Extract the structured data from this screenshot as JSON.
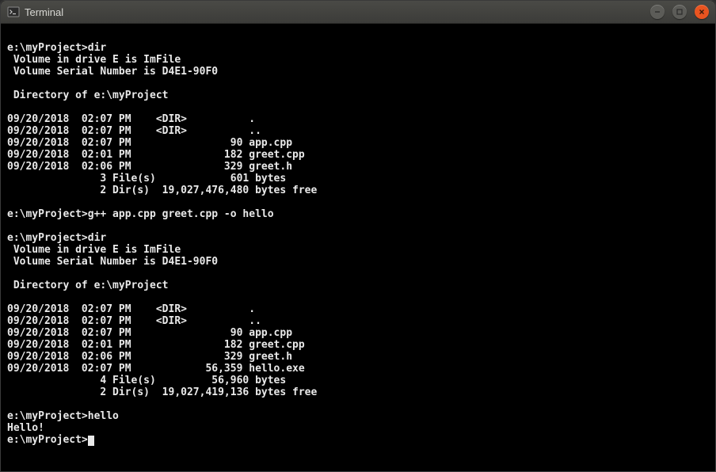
{
  "window": {
    "title": "Terminal"
  },
  "terminal": {
    "lines": [
      "",
      "e:\\myProject>dir",
      " Volume in drive E is ImFile",
      " Volume Serial Number is D4E1-90F0",
      "",
      " Directory of e:\\myProject",
      "",
      "09/20/2018  02:07 PM    <DIR>          .",
      "09/20/2018  02:07 PM    <DIR>          ..",
      "09/20/2018  02:07 PM                90 app.cpp",
      "09/20/2018  02:01 PM               182 greet.cpp",
      "09/20/2018  02:06 PM               329 greet.h",
      "               3 File(s)            601 bytes",
      "               2 Dir(s)  19,027,476,480 bytes free",
      "",
      "e:\\myProject>g++ app.cpp greet.cpp -o hello",
      "",
      "e:\\myProject>dir",
      " Volume in drive E is ImFile",
      " Volume Serial Number is D4E1-90F0",
      "",
      " Directory of e:\\myProject",
      "",
      "09/20/2018  02:07 PM    <DIR>          .",
      "09/20/2018  02:07 PM    <DIR>          ..",
      "09/20/2018  02:07 PM                90 app.cpp",
      "09/20/2018  02:01 PM               182 greet.cpp",
      "09/20/2018  02:06 PM               329 greet.h",
      "09/20/2018  02:07 PM            56,359 hello.exe",
      "               4 File(s)         56,960 bytes",
      "               2 Dir(s)  19,027,419,136 bytes free",
      "",
      "e:\\myProject>hello",
      "Hello!",
      "e:\\myProject>"
    ]
  }
}
